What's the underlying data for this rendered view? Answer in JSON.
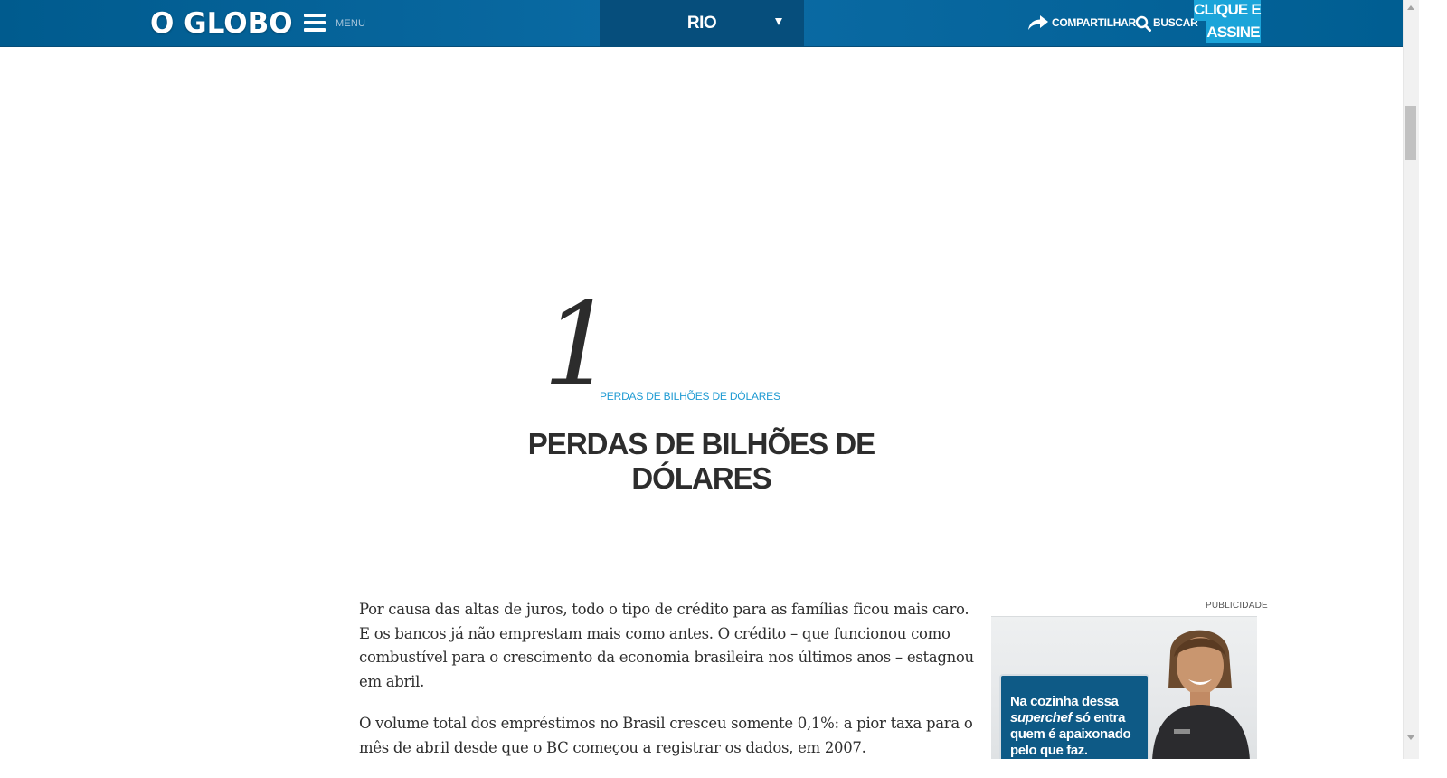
{
  "header": {
    "logo": "O GLOBO",
    "menu_label": "MENU",
    "section": "RIO",
    "share_label": "COMPARTILHAR",
    "search_label": "BUSCAR",
    "subscribe_line1": "CLIQUE E",
    "subscribe_line2": "ASSINE",
    "icons": [
      "hamburger-icon",
      "chevron-down-icon",
      "share-arrow-icon",
      "search-icon"
    ]
  },
  "chapter": {
    "number": "1",
    "kicker": "PERDAS DE BILHÕES DE DÓLARES",
    "title": "PERDAS DE BILHÕES DE DÓLARES"
  },
  "article": {
    "paragraphs": [
      "Por causa das altas de juros, todo o tipo de crédito para as famílias ficou mais caro. E os bancos já não emprestam mais como antes. O crédito – que funcionou como combustível para o crescimento da economia brasileira nos últimos anos – estagnou em abril.",
      "O volume total dos empréstimos no Brasil cresceu somente 0,1%: a pior taxa para o mês de abril desde que o BC começou a registrar os dados, em 2007."
    ]
  },
  "ad": {
    "label": "PUBLICIDADE",
    "copy_line1": "Na cozinha dessa",
    "copy_em": "superchef",
    "copy_line2": " só entra",
    "copy_line3": "quem é apaixonado",
    "copy_line4": "pelo que faz."
  },
  "colors": {
    "header_blue": "#0a6aa3",
    "section_dark": "#064e7c",
    "accent_cyan": "#1ba4d9",
    "kicker_blue": "#1f9bd3"
  }
}
